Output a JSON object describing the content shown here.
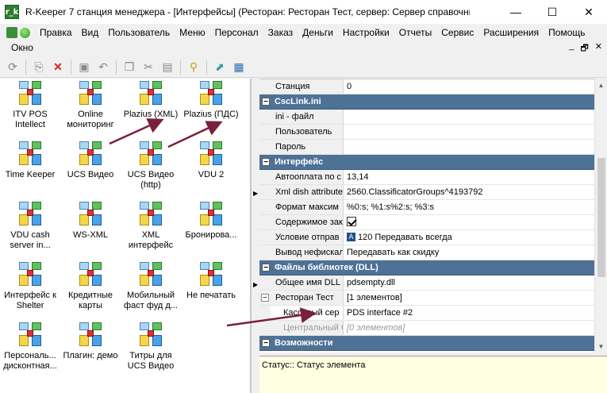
{
  "window": {
    "app_icon_text": "r_k",
    "title": "R-Keeper 7 станция менеджера - [Интерфейсы] (Ресторан: Ресторан Тест, сервер: Сервер справочников [rk...",
    "minimize": "—",
    "maximize": "☐",
    "close": "✕"
  },
  "menu": {
    "items": [
      "Правка",
      "Вид",
      "Пользователь",
      "Меню",
      "Персонал",
      "Заказ",
      "Деньги",
      "Настройки",
      "Отчеты",
      "Сервис",
      "Расширения",
      "Помощь"
    ],
    "second_row": "Окно",
    "mdi_min": "_",
    "mdi_restore": "🗗",
    "mdi_close": "✕"
  },
  "toolbar": {
    "buttons": [
      "refresh-icon",
      "new-icon",
      "delete-icon",
      "save-icon",
      "undo-icon",
      "copy-icon",
      "cut-icon",
      "paste-icon",
      "find-icon",
      "export-icon",
      "view-grid-icon"
    ]
  },
  "interfaces": [
    {
      "label": "ITV POS\nIntellect"
    },
    {
      "label": "Online\nмониторинг"
    },
    {
      "label": "Plazius (XML)"
    },
    {
      "label": "Plazius (ПДС)"
    },
    {
      "label": "Time Keeper"
    },
    {
      "label": "UCS Видео"
    },
    {
      "label": "UCS Видео\n(http)"
    },
    {
      "label": "VDU 2"
    },
    {
      "label": "VDU cash\nserver in..."
    },
    {
      "label": "WS-XML"
    },
    {
      "label": "XML\nинтерфейс"
    },
    {
      "label": "Бронирова..."
    },
    {
      "label": "Интерфейс к\nShelter"
    },
    {
      "label": "Кредитные\nкарты"
    },
    {
      "label": "Мобильный\nфаст фуд д..."
    },
    {
      "label": "Не печатать"
    },
    {
      "label": "Персональ...\nдисконтная..."
    },
    {
      "label": "Плагин: демо"
    },
    {
      "label": "Титры для\nUCS Видео"
    }
  ],
  "properties": {
    "station_name": "Станция",
    "station_value": "0",
    "cat_csclink": "CscLink.ini",
    "ini_file": "ini - файл",
    "user": "Пользователь",
    "password": "Пароль",
    "cat_interface": "Интерфейс",
    "autopay_name": "Автооплата по с",
    "autopay_value": "13,14",
    "xml_dish_name": "Xml dish attributes",
    "xml_dish_value": "2560.ClassificatorGroups^4193792",
    "format_name": "Формат максим",
    "format_value": "%0:s; %1:s%2:s; %3:s",
    "content_name": "Содержимое зак",
    "condition_name": "Условие отправ",
    "condition_symbol": "A",
    "condition_value": "120 Передавать всегда",
    "nonfiscal_name": "Вывод нефискал",
    "nonfiscal_value": "Передавать как скидку",
    "cat_dll": "Файлы библиотек (DLL)",
    "dll_name": "Общее имя DLL",
    "dll_value": "pdsempty.dll",
    "restaurant_name": "Ресторан Тест",
    "restaurant_value": "[1 элементов]",
    "cash_server_name": "Кассовый сер",
    "cash_server_value": "PDS interface #2",
    "central_name": "Центральный Оф",
    "central_value": "[0 элементов]",
    "cat_features": "Возможности"
  },
  "status": {
    "text": "Статус:: Статус элемента"
  },
  "colors": {
    "category_header": "#4e7196",
    "status_bg": "#ffffe1",
    "annotation_arrow": "#7a1f3d"
  }
}
